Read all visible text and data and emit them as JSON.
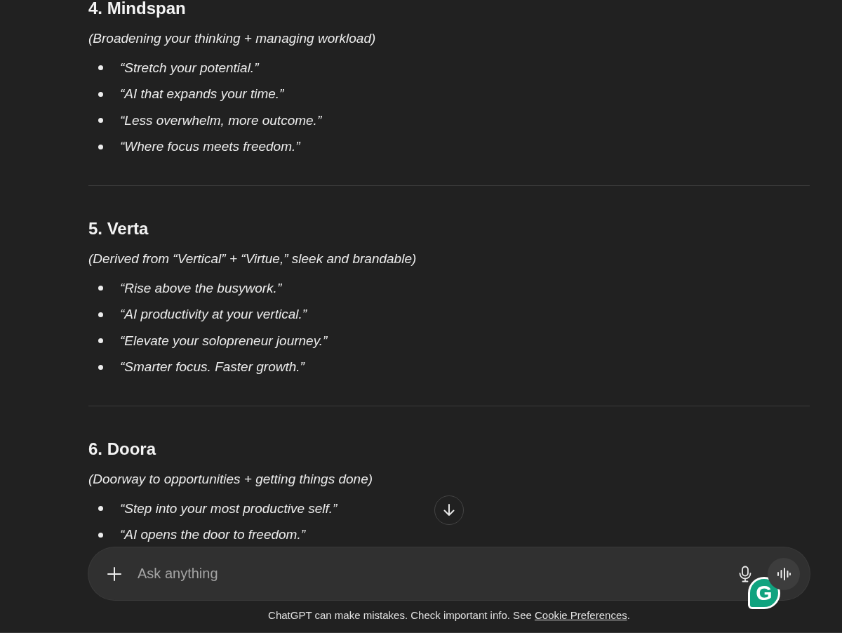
{
  "sections": [
    {
      "title": "4. Mindspan",
      "subtitle": "(Broadening your thinking + managing workload)",
      "bullets": [
        "“Stretch your potential.”",
        "“AI that expands your time.”",
        "“Less overwhelm, more outcome.”",
        "“Where focus meets freedom.”"
      ]
    },
    {
      "title": "5. Verta",
      "subtitle": "(Derived from “Vertical” + “Virtue,” sleek and brandable)",
      "bullets": [
        "“Rise above the busywork.”",
        "“AI productivity at your vertical.”",
        "“Elevate your solopreneur journey.”",
        "“Smarter focus. Faster growth.”"
      ]
    },
    {
      "title": "6. Doora",
      "subtitle": "(Doorway to opportunities + getting things done)",
      "bullets": [
        "“Step into your most productive self.”",
        "“AI opens the door to freedom.”"
      ]
    }
  ],
  "composer": {
    "placeholder": "Ask anything"
  },
  "extension_badge": {
    "letter": "G"
  },
  "footer": {
    "text": "ChatGPT can make mistakes. Check important info. See ",
    "link": "Cookie Preferences",
    "end": "."
  }
}
